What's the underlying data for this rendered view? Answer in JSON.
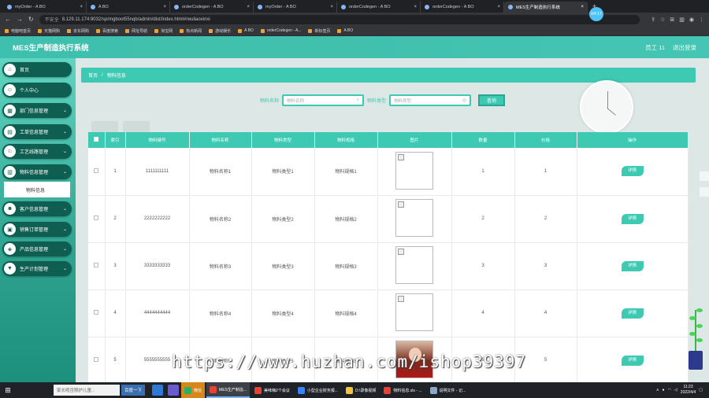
{
  "browser": {
    "tabs": [
      {
        "label": "myOrder - A BO"
      },
      {
        "label": "A BO"
      },
      {
        "label": "orderCodegen - A BO"
      },
      {
        "label": "myOrder - A BO"
      },
      {
        "label": "orderCodegen - A BO"
      },
      {
        "label": "orderCodegen - A BO"
      },
      {
        "label": "MES生产制造执行系统"
      }
    ],
    "security": "不安全",
    "url": "8.129.11.174:9032/springboot55nqb/admin/dist/index.html#/wuliaoxinxi",
    "timer": "04:17",
    "bookmarks": [
      "电脑吧首页",
      "天猫网购",
      "京东网购",
      "百度搜索",
      "网址导航",
      "淘宝网",
      "热点新闻",
      "游戏娱乐",
      "A BO",
      "orderCodegen - A...",
      "新标签页",
      "A BO"
    ]
  },
  "header": {
    "title": "MES生产制造执行系统",
    "user": "员工 11",
    "logout": "退出登录"
  },
  "sidebar": {
    "items": [
      {
        "label": "首页",
        "icon": "home-icon"
      },
      {
        "label": "个人中心",
        "icon": "user-icon"
      },
      {
        "label": "部门信息管理",
        "icon": "grid-icon"
      },
      {
        "label": "工单信息管理",
        "icon": "ticket-icon"
      },
      {
        "label": "工艺线路管理",
        "icon": "route-icon"
      },
      {
        "label": "物料信息管理",
        "icon": "chart-icon"
      },
      {
        "label": "客户信息管理",
        "icon": "customer-icon"
      },
      {
        "label": "销售订单管理",
        "icon": "order-icon"
      },
      {
        "label": "产品信息管理",
        "icon": "product-icon"
      },
      {
        "label": "生产计划管理",
        "icon": "plan-icon"
      }
    ],
    "subitem": "物料信息"
  },
  "breadcrumb": {
    "home": "首页",
    "sep": "/",
    "current": "物料信息"
  },
  "search": {
    "name_label": "物料名称",
    "name_placeholder": "物料名称",
    "type_label": "物料类型",
    "type_placeholder": "物料类型",
    "button": "查询"
  },
  "table": {
    "headers": [
      "",
      "索引",
      "物料编号",
      "物料名称",
      "物料类型",
      "物料规格",
      "图片",
      "数量",
      "价格",
      "操作"
    ],
    "detail_label": "详情",
    "rows": [
      {
        "index": "1",
        "code": "1111111111",
        "name": "物料名称1",
        "type": "物料类型1",
        "spec": "物料规格1",
        "qty": "1",
        "price": "1",
        "image": "broken"
      },
      {
        "index": "2",
        "code": "2222222222",
        "name": "物料名称2",
        "type": "物料类型2",
        "spec": "物料规格2",
        "qty": "2",
        "price": "2",
        "image": "broken"
      },
      {
        "index": "3",
        "code": "3333333333",
        "name": "物料名称3",
        "type": "物料类型3",
        "spec": "物料规格3",
        "qty": "3",
        "price": "3",
        "image": "broken"
      },
      {
        "index": "4",
        "code": "4444444444",
        "name": "物料名称4",
        "type": "物料类型4",
        "spec": "物料规格4",
        "qty": "4",
        "price": "4",
        "image": "broken"
      },
      {
        "index": "5",
        "code": "5555555555",
        "name": "物料名称5",
        "type": "物料类型5",
        "spec": "物料规格5",
        "qty": "5",
        "price": "5",
        "image": "photo"
      }
    ]
  },
  "watermark": "https://www.huzhan.com/ishop39397",
  "taskbar": {
    "search_placeholder": "家长呢否限护儿童...",
    "search_button": "百度一下",
    "apps": [
      {
        "label": "微信",
        "color": "#2aae67"
      },
      {
        "label": "MES生产制造...",
        "color": "#e94235"
      },
      {
        "label": "美味嗨2个会议",
        "color": "#e94235"
      },
      {
        "label": "小型企业财务报...",
        "color": "#3b82f6"
      },
      {
        "label": "D:\\录像视频",
        "color": "#f4c542"
      },
      {
        "label": "物料信息.xls - ...",
        "color": "#e94235"
      },
      {
        "label": "说明文件 - 记...",
        "color": "#8fa8c8"
      }
    ],
    "time": "11:23",
    "date": "2022/4/4"
  }
}
